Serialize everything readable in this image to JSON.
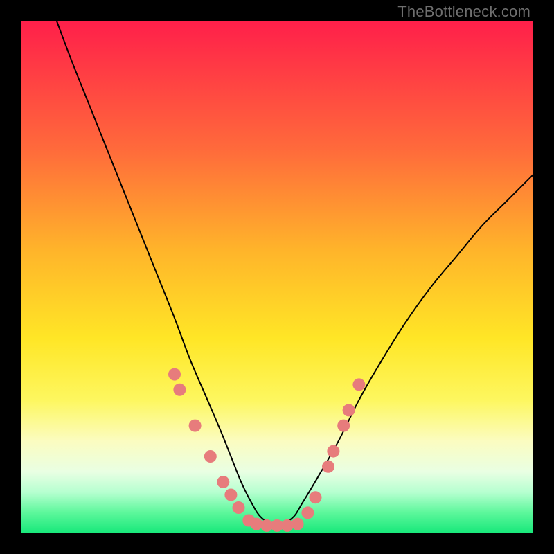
{
  "watermark": "TheBottleneck.com",
  "colors": {
    "frame": "#000000",
    "curve": "#000000",
    "dot": "#e77c7c",
    "gradient_stops": [
      "#ff1f4a",
      "#ff3745",
      "#ff6a3b",
      "#ffb52a",
      "#ffe626",
      "#fdf75f",
      "#fbfcc0",
      "#e9ffe3",
      "#b6ffd0",
      "#5cf79b",
      "#17e87a"
    ]
  },
  "chart_data": {
    "type": "line",
    "title": "",
    "xlabel": "",
    "ylabel": "",
    "xlim": [
      0,
      100
    ],
    "ylim": [
      0,
      100
    ],
    "series": [
      {
        "name": "bottleneck-curve",
        "x": [
          7,
          10,
          14,
          18,
          22,
          26,
          30,
          33,
          36,
          39,
          41,
          43,
          45,
          47,
          50,
          53,
          55,
          58,
          62,
          66,
          70,
          75,
          80,
          85,
          90,
          95,
          100
        ],
        "y": [
          100,
          92,
          82,
          72,
          62,
          52,
          42,
          34,
          27,
          20,
          15,
          10,
          6,
          3,
          1.5,
          3,
          6,
          11,
          18,
          26,
          33,
          41,
          48,
          54,
          60,
          65,
          70
        ]
      }
    ],
    "markers": {
      "name": "highlighted-points",
      "note": "salmon dots near the valley on both arms plus flat bottom",
      "points": [
        {
          "x": 30,
          "y": 31
        },
        {
          "x": 31,
          "y": 28
        },
        {
          "x": 34,
          "y": 21
        },
        {
          "x": 37,
          "y": 15
        },
        {
          "x": 39.5,
          "y": 10
        },
        {
          "x": 41,
          "y": 7.5
        },
        {
          "x": 42.5,
          "y": 5
        },
        {
          "x": 44.5,
          "y": 2.5
        },
        {
          "x": 46,
          "y": 1.8
        },
        {
          "x": 48,
          "y": 1.5
        },
        {
          "x": 50,
          "y": 1.5
        },
        {
          "x": 52,
          "y": 1.5
        },
        {
          "x": 54,
          "y": 1.8
        },
        {
          "x": 56,
          "y": 4
        },
        {
          "x": 57.5,
          "y": 7
        },
        {
          "x": 60,
          "y": 13
        },
        {
          "x": 61,
          "y": 16
        },
        {
          "x": 63,
          "y": 21
        },
        {
          "x": 64,
          "y": 24
        },
        {
          "x": 66,
          "y": 29
        }
      ]
    }
  }
}
